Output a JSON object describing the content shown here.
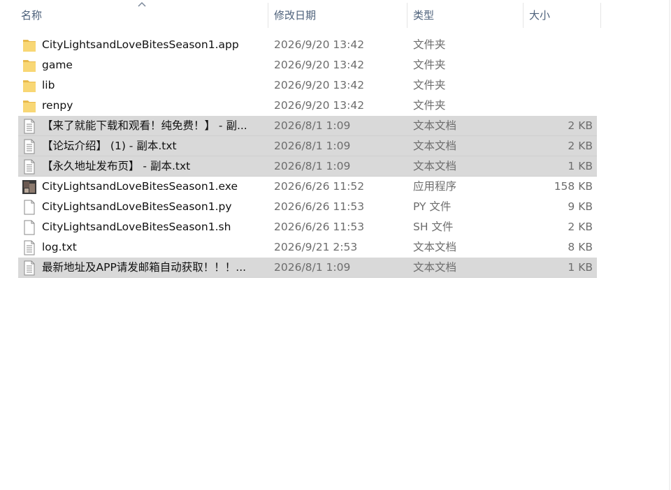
{
  "header": {
    "name": "名称",
    "date": "修改日期",
    "type": "类型",
    "size": "大小"
  },
  "colors": {
    "header_text": "#4c607a",
    "selected_row": "#d9d9d9",
    "folder": "#f8d775"
  },
  "files": [
    {
      "name": "CityLightsandLoveBitesSeason1.app",
      "date": "2026/9/20 13:42",
      "type": "文件夹",
      "size": "",
      "icon": "folder-icon",
      "selected": false
    },
    {
      "name": "game",
      "date": "2026/9/20 13:42",
      "type": "文件夹",
      "size": "",
      "icon": "folder-icon",
      "selected": false
    },
    {
      "name": "lib",
      "date": "2026/9/20 13:42",
      "type": "文件夹",
      "size": "",
      "icon": "folder-icon",
      "selected": false
    },
    {
      "name": "renpy",
      "date": "2026/9/20 13:42",
      "type": "文件夹",
      "size": "",
      "icon": "folder-icon",
      "selected": false
    },
    {
      "name": "【来了就能下载和观看！纯免费！】 - 副...",
      "date": "2026/8/1 1:09",
      "type": "文本文档",
      "size": "2 KB",
      "icon": "text-file-icon",
      "selected": true
    },
    {
      "name": "【论坛介绍】 (1) - 副本.txt",
      "date": "2026/8/1 1:09",
      "type": "文本文档",
      "size": "2 KB",
      "icon": "text-file-icon",
      "selected": true
    },
    {
      "name": "【永久地址发布页】 - 副本.txt",
      "date": "2026/8/1 1:09",
      "type": "文本文档",
      "size": "1 KB",
      "icon": "text-file-icon",
      "selected": true
    },
    {
      "name": "CityLightsandLoveBitesSeason1.exe",
      "date": "2026/6/26 11:52",
      "type": "应用程序",
      "size": "158 KB",
      "icon": "app-thumbnail-icon",
      "selected": false
    },
    {
      "name": "CityLightsandLoveBitesSeason1.py",
      "date": "2026/6/26 11:53",
      "type": "PY 文件",
      "size": "9 KB",
      "icon": "blank-file-icon",
      "selected": false
    },
    {
      "name": "CityLightsandLoveBitesSeason1.sh",
      "date": "2026/6/26 11:53",
      "type": "SH 文件",
      "size": "2 KB",
      "icon": "blank-file-icon",
      "selected": false
    },
    {
      "name": "log.txt",
      "date": "2026/9/21 2:53",
      "type": "文本文档",
      "size": "8 KB",
      "icon": "text-file-icon",
      "selected": false
    },
    {
      "name": "最新地址及APP请发邮箱自动获取！！！...",
      "date": "2026/8/1 1:09",
      "type": "文本文档",
      "size": "1 KB",
      "icon": "text-file-icon",
      "selected": true
    }
  ]
}
